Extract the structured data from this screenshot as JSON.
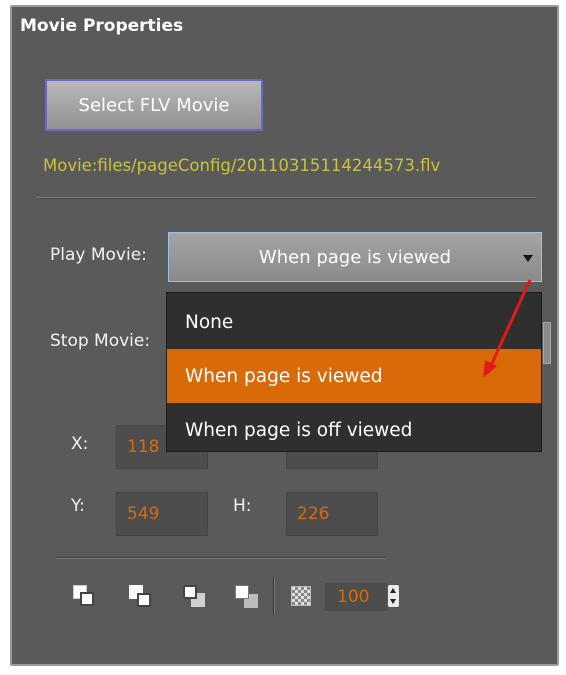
{
  "panel": {
    "title": "Movie Properties"
  },
  "select_button": {
    "label": "Select FLV Movie"
  },
  "movie_path": "Movie:files/pageConfig/20110315114244573.flv",
  "play_movie": {
    "label": "Play Movie:",
    "value": "When page is viewed"
  },
  "stop_movie": {
    "label": "Stop Movie:"
  },
  "dropdown": {
    "options": [
      "None",
      "When page is viewed",
      "When page is off viewed"
    ],
    "selected": "When page is viewed"
  },
  "position": {
    "x_label": "X:",
    "x_value": "118",
    "y_label": "Y:",
    "y_value": "549",
    "h_label": "H:",
    "h_value": "226"
  },
  "toolbar": {
    "icons": [
      "bring-to-front-icon",
      "bring-forward-icon",
      "send-backward-icon",
      "send-to-back-icon"
    ],
    "opacity_value": "100"
  },
  "colors": {
    "accent": "#d96a08",
    "path_text": "#c8c338",
    "panel_bg": "#5a5a5a"
  }
}
